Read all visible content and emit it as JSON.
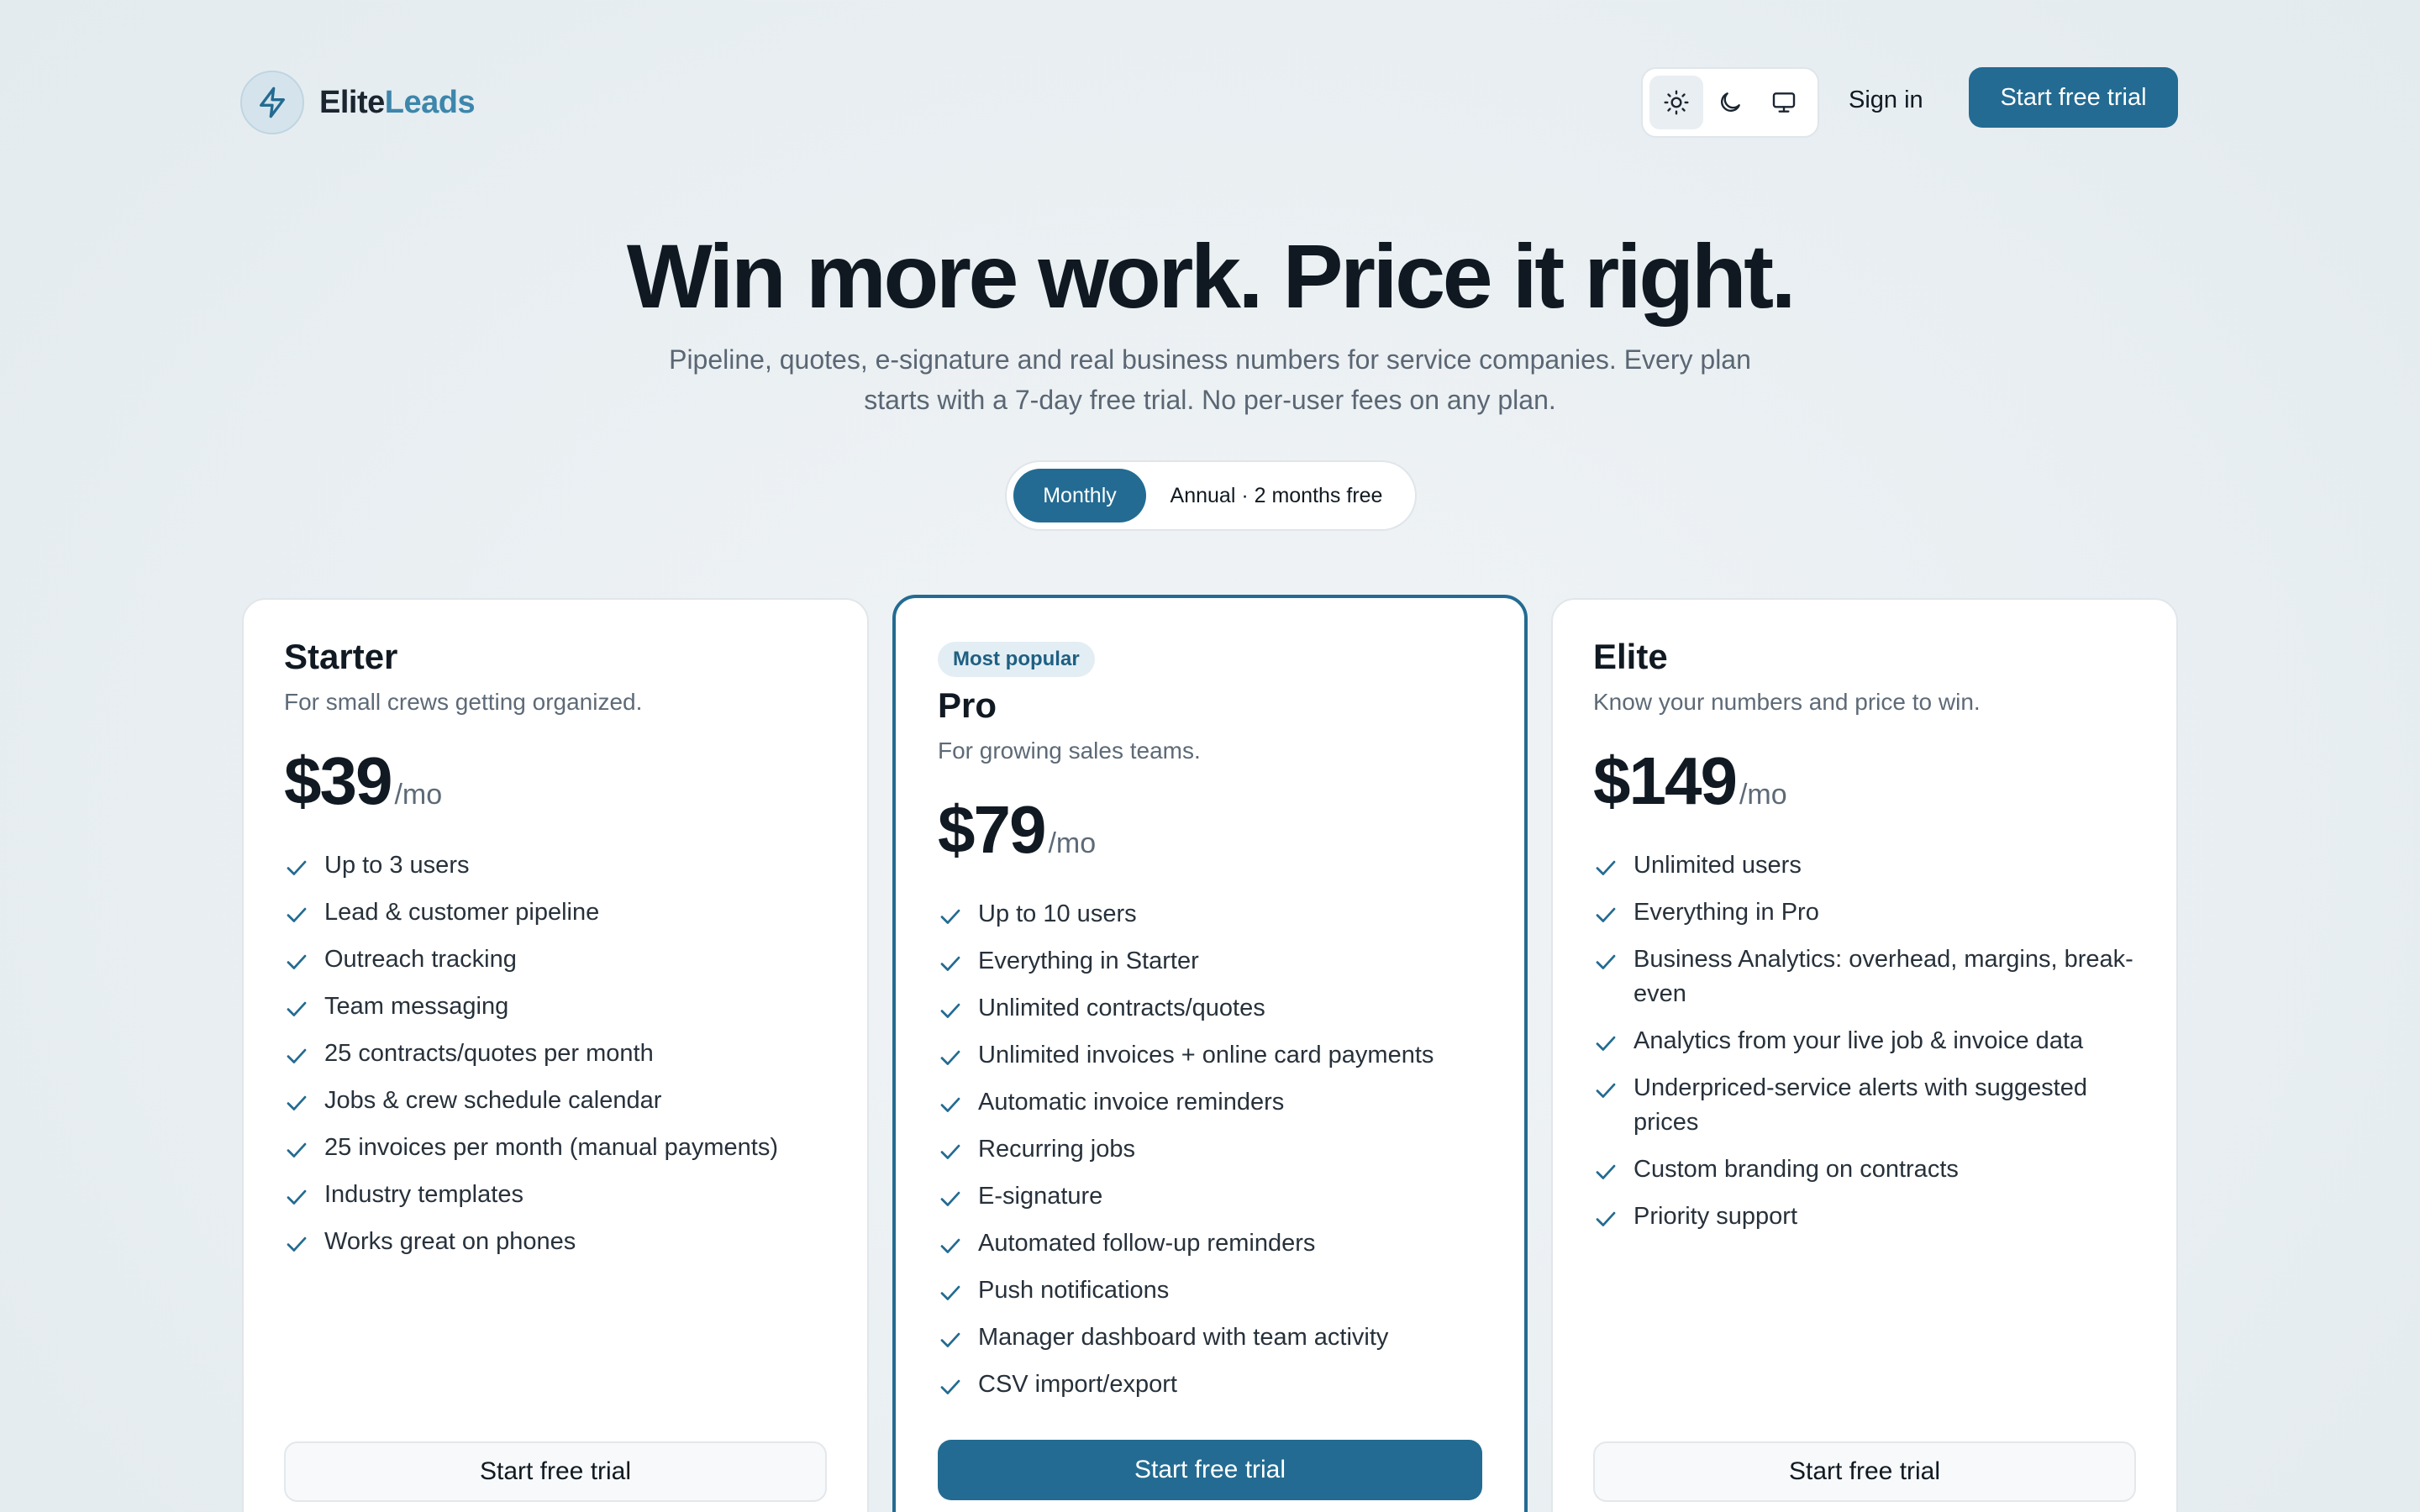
{
  "brand": {
    "name_part1": "Elite",
    "name_part2": "Leads",
    "logo_icon": "lightning-bolt-icon"
  },
  "header": {
    "theme_options": [
      {
        "icon": "sun-icon",
        "active": true
      },
      {
        "icon": "moon-icon",
        "active": false
      },
      {
        "icon": "monitor-icon",
        "active": false
      }
    ],
    "signin_label": "Sign in",
    "cta_label": "Start free trial"
  },
  "hero": {
    "title": "Win more work. Price it right.",
    "subtitle": "Pipeline, quotes, e-signature and real business numbers for service companies. Every plan starts with a 7-day free trial. No per-user fees on any plan."
  },
  "billing": {
    "monthly_label": "Monthly",
    "annual_label": "Annual · 2 months free",
    "selected": "monthly"
  },
  "plans": {
    "starter": {
      "name": "Starter",
      "description": "For small crews getting organized.",
      "price": "$39",
      "period": "/mo",
      "button": "Start free trial",
      "features": [
        "Up to 3 users",
        "Lead & customer pipeline",
        "Outreach tracking",
        "Team messaging",
        "25 contracts/quotes per month",
        "Jobs & crew schedule calendar",
        "25 invoices per month (manual payments)",
        "Industry templates",
        "Works great on phones"
      ]
    },
    "pro": {
      "badge": "Most popular",
      "name": "Pro",
      "description": "For growing sales teams.",
      "price": "$79",
      "period": "/mo",
      "button": "Start free trial",
      "features": [
        "Up to 10 users",
        "Everything in Starter",
        "Unlimited contracts/quotes",
        "Unlimited invoices + online card payments",
        "Automatic invoice reminders",
        "Recurring jobs",
        "E-signature",
        "Automated follow-up reminders",
        "Push notifications",
        "Manager dashboard with team activity",
        "CSV import/export"
      ]
    },
    "elite": {
      "name": "Elite",
      "description": "Know your numbers and price to win.",
      "price": "$149",
      "period": "/mo",
      "button": "Start free trial",
      "features": [
        "Unlimited users",
        "Everything in Pro",
        "Business Analytics: overhead, margins, break-even",
        "Analytics from your live job & invoice data",
        "Underpriced-service alerts with suggested prices",
        "Custom branding on contracts",
        "Priority support"
      ]
    }
  },
  "colors": {
    "accent": "#236b92",
    "brand_secondary": "#3d86ac",
    "check": "#236b92"
  }
}
